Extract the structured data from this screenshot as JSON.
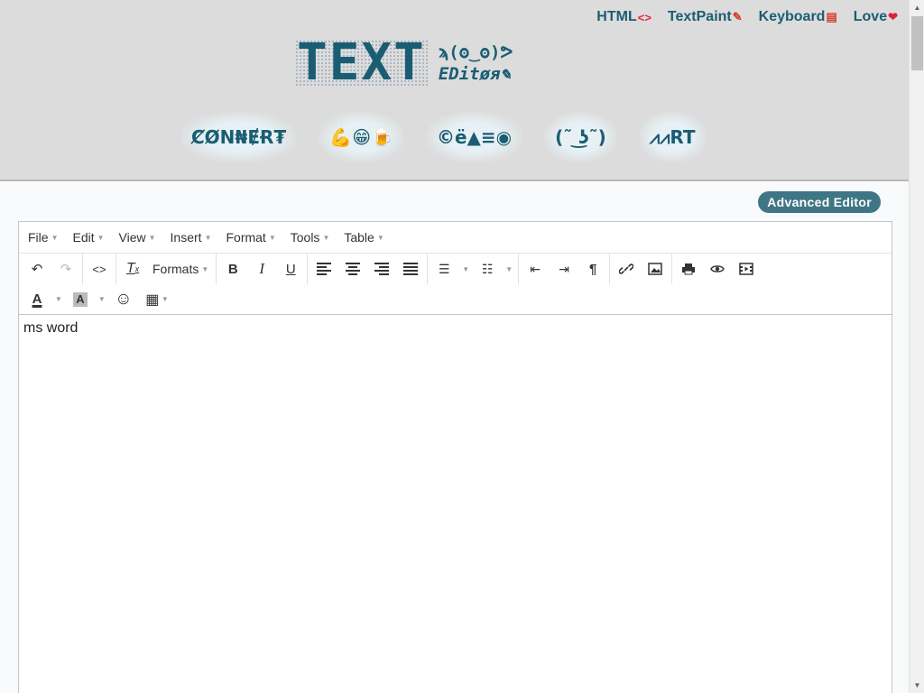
{
  "top_links": [
    {
      "label": "HTML",
      "mark": "<>",
      "mark_class": "mark-code",
      "icon": "code-icon"
    },
    {
      "label": "TextPaint",
      "mark": "✎",
      "mark_class": "mark-pen",
      "icon": "pencil-icon"
    },
    {
      "label": "Keyboard",
      "mark": "▤",
      "mark_class": "mark-kbd",
      "icon": "keyboard-icon"
    },
    {
      "label": "Love",
      "mark": "❤",
      "mark_class": "mark-heart",
      "icon": "heart-icon"
    }
  ],
  "logo": {
    "main": "TEXT",
    "line1": "ϡ(ʘ‿ʘ)ᕗ",
    "line2": "EDitøя✎"
  },
  "nav_buttons": [
    "ȻØN₦ɆɌ₮",
    "💪😁🍺",
    "©ë▲≡◉",
    "(˜ ͜ʖ˜)",
    "⩘⩘RT"
  ],
  "advanced_editor": "Advanced Editor",
  "menubar": [
    "File",
    "Edit",
    "View",
    "Insert",
    "Format",
    "Tools",
    "Table"
  ],
  "toolbar": {
    "formats": "Formats",
    "undo": "↶",
    "redo": "↷",
    "code": "<>",
    "clear": "Tx",
    "bold": "B",
    "italic": "I",
    "underline": "U",
    "pilcrow": "¶",
    "link": "🔗",
    "image": "▨",
    "print": "🖶",
    "preview": "◉",
    "media": "▣",
    "textcolor": "A",
    "bgcolor": "A",
    "emoji": "☺",
    "table": "▦"
  },
  "editor_content": "ms word",
  "colors": {
    "accent": "#1a5d73",
    "button": "#3f7686"
  }
}
